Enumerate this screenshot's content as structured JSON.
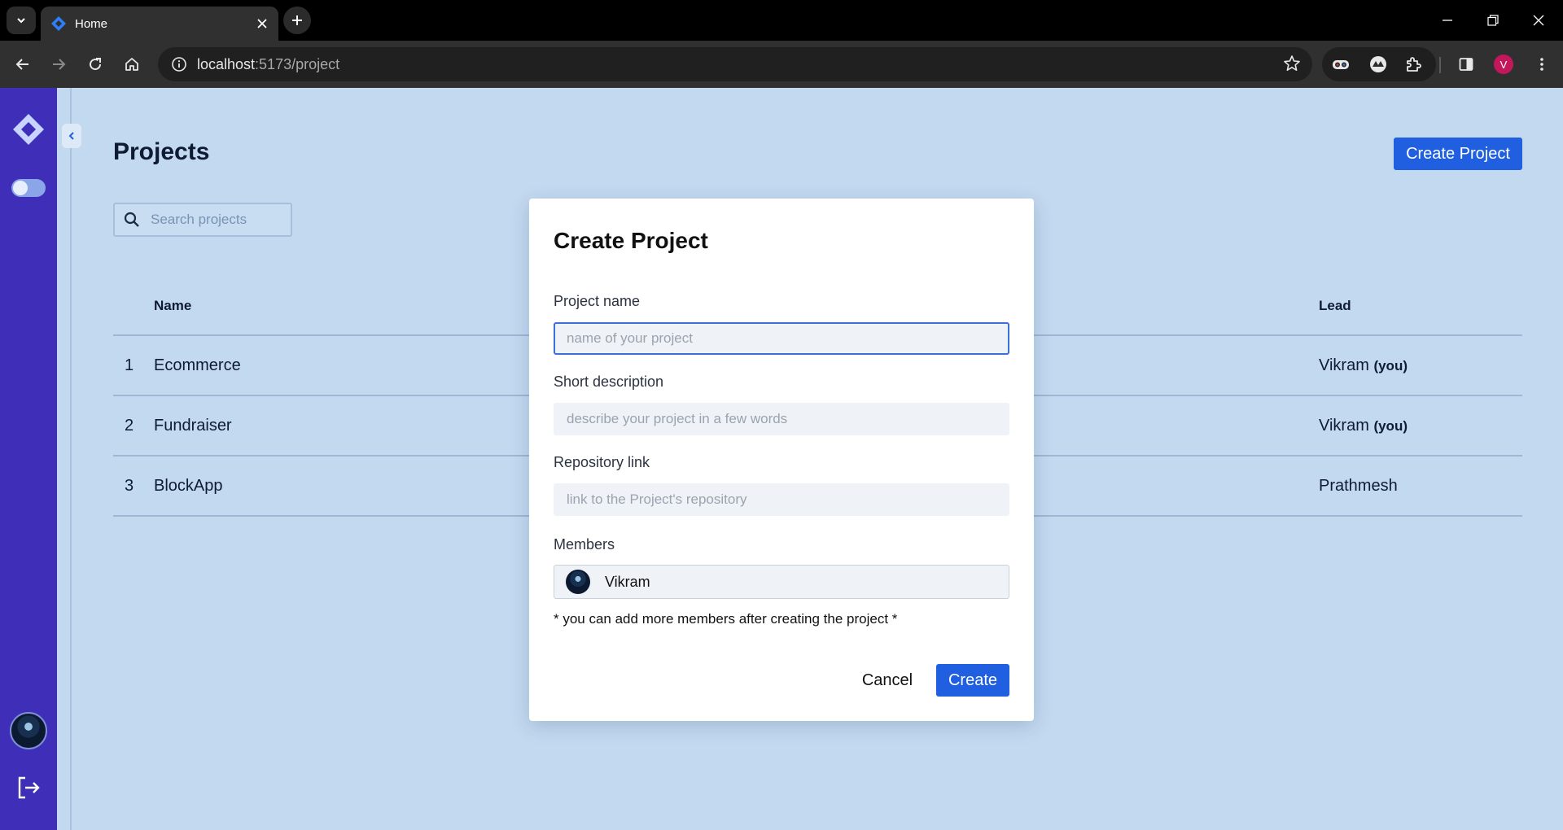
{
  "browser": {
    "tab_title": "Home",
    "url_host": "localhost",
    "url_path": ":5173/project",
    "profile_initial": "V"
  },
  "icons": {
    "tab_dropdown": "chevron-down-icon",
    "new_tab": "plus-icon",
    "back": "arrow-left-icon",
    "forward": "arrow-right-icon",
    "reload": "reload-icon",
    "home": "home-icon",
    "site_info": "info-icon",
    "bookmark": "star-icon",
    "extensions": "puzzle-icon",
    "side_panel": "side-panel-icon",
    "menu": "kebab-icon",
    "logout": "logout-icon",
    "search": "search-icon",
    "collapse": "chevron-left-icon"
  },
  "colors": {
    "sidebar": "#3f2fb8",
    "page_background": "#c3d9f0",
    "primary_button": "#1f5fe0",
    "profile": "#c2185b"
  },
  "page": {
    "title": "Projects",
    "create_button": "Create Project",
    "search_placeholder": "Search projects"
  },
  "table": {
    "headers": {
      "name": "Name",
      "lead": "Lead"
    },
    "rows": [
      {
        "num": "1",
        "name": "Ecommerce",
        "lead": "Vikram",
        "lead_tag": "(you)"
      },
      {
        "num": "2",
        "name": "Fundraiser",
        "lead": "Vikram",
        "lead_tag": "(you)"
      },
      {
        "num": "3",
        "name": "BlockApp",
        "lead": "Prathmesh",
        "lead_tag": ""
      }
    ]
  },
  "modal": {
    "title": "Create Project",
    "fields": {
      "name": {
        "label": "Project name",
        "placeholder": "name of your project"
      },
      "description": {
        "label": "Short description",
        "placeholder": "describe your project in a few words"
      },
      "repo": {
        "label": "Repository link",
        "placeholder": "link to the Project's repository"
      }
    },
    "members_label": "Members",
    "members": [
      {
        "name": "Vikram"
      }
    ],
    "hint": "* you can add more members after creating the project *",
    "cancel": "Cancel",
    "create": "Create"
  }
}
